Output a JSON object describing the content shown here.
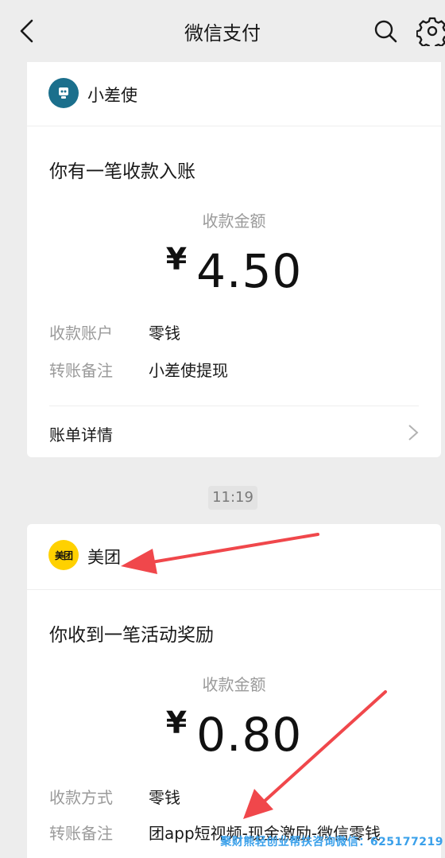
{
  "header": {
    "title": "微信支付"
  },
  "messages": [
    {
      "source": "小差使",
      "title": "你有一笔收款入账",
      "amount_label": "收款金额",
      "currency": "¥",
      "amount": "4.50",
      "rows": [
        {
          "key": "收款账户",
          "value": "零钱"
        },
        {
          "key": "转账备注",
          "value": "小差使提现"
        }
      ],
      "detail_label": "账单详情"
    },
    {
      "source": "美团",
      "avatar_text": "美团",
      "title": "你收到一笔活动奖励",
      "amount_label": "收款金额",
      "currency": "¥",
      "amount": "0.80",
      "rows": [
        {
          "key": "收款方式",
          "value": "零钱"
        },
        {
          "key": "转账备注",
          "value": "团app短视频-现金激励-微信零钱"
        }
      ]
    }
  ],
  "time_badge": "11:19",
  "watermark": "聚财熊轻创业帮扶咨询微信：625177219",
  "colors": {
    "annotation_arrow": "#f0474b",
    "watermark": "#3aa0ea",
    "meituan_yellow": "#ffd100"
  },
  "icons": [
    "back-arrow-icon",
    "search-icon",
    "settings-gear-icon",
    "chevron-right-icon"
  ]
}
